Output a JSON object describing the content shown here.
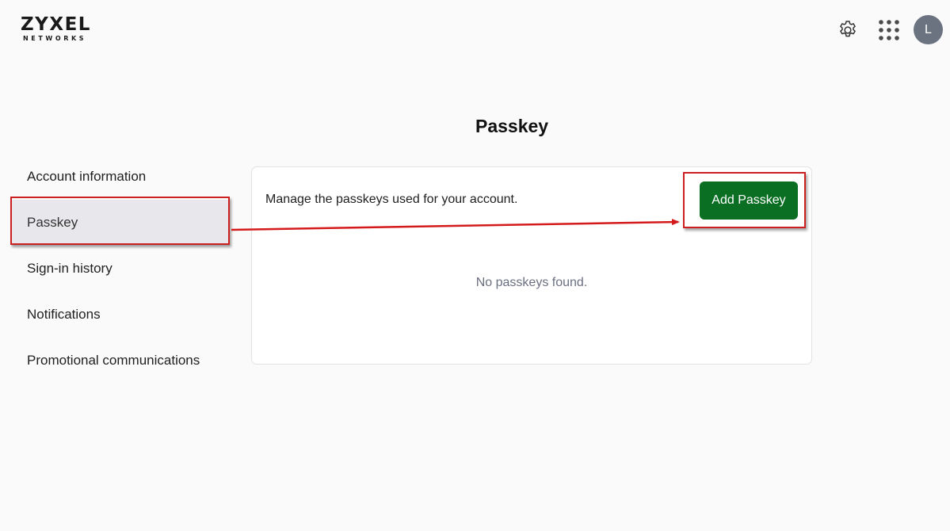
{
  "logo": {
    "main": "ZYXEL",
    "sub": "NETWORKS"
  },
  "header": {
    "settings_icon": "gear-icon",
    "apps_icon": "grid-icon",
    "avatar_initial": "L",
    "avatar_color": "#6b7280"
  },
  "page": {
    "title": "Passkey"
  },
  "sidebar": {
    "items": [
      {
        "label": "Account information",
        "active": false
      },
      {
        "label": "Passkey",
        "active": true
      },
      {
        "label": "Sign-in history",
        "active": false
      },
      {
        "label": "Notifications",
        "active": false
      },
      {
        "label": "Promotional communications",
        "active": false
      }
    ]
  },
  "card": {
    "description": "Manage the passkeys used for your account.",
    "add_button_label": "Add Passkey",
    "empty_message": "No passkeys found."
  },
  "colors": {
    "accent_green": "#0a6e23",
    "annotation_red": "#cc1f1f",
    "active_bg": "#e8e8ec"
  }
}
